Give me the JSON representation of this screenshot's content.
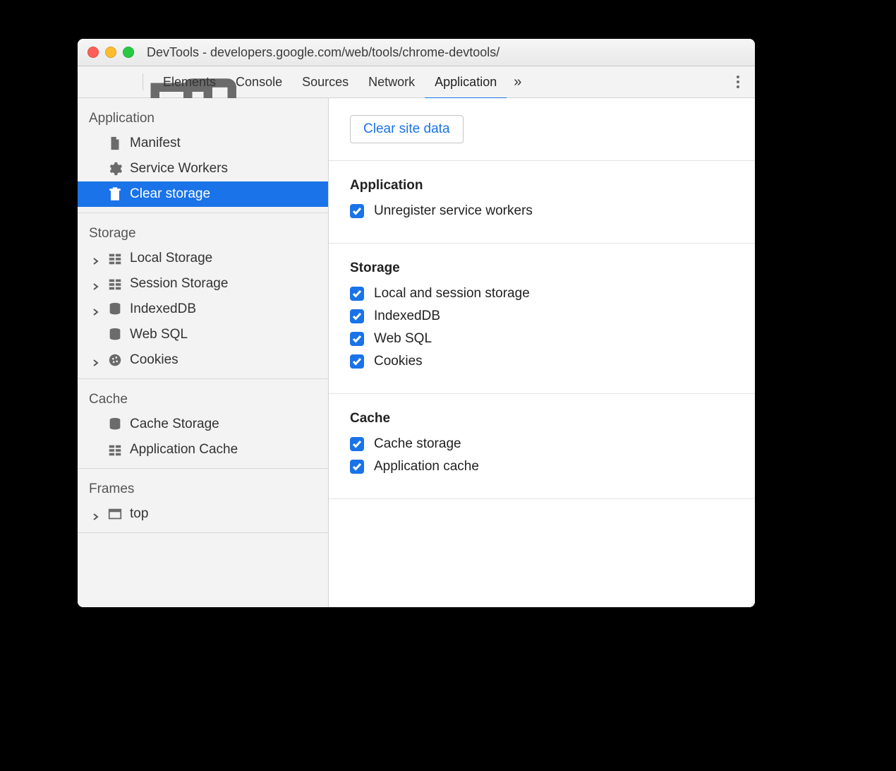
{
  "window_title": "DevTools - developers.google.com/web/tools/chrome-devtools/",
  "tabs": {
    "t0": "Elements",
    "t1": "Console",
    "t2": "Sources",
    "t3": "Network",
    "t4": "Application",
    "overflow": "»"
  },
  "sidebar": {
    "groups": [
      {
        "title": "Application",
        "items": [
          {
            "label": "Manifest",
            "icon": "file",
            "expandable": false
          },
          {
            "label": "Service Workers",
            "icon": "gear",
            "expandable": false
          },
          {
            "label": "Clear storage",
            "icon": "trash",
            "expandable": false,
            "selected": true
          }
        ]
      },
      {
        "title": "Storage",
        "items": [
          {
            "label": "Local Storage",
            "icon": "table",
            "expandable": true
          },
          {
            "label": "Session Storage",
            "icon": "table",
            "expandable": true
          },
          {
            "label": "IndexedDB",
            "icon": "db",
            "expandable": true
          },
          {
            "label": "Web SQL",
            "icon": "db",
            "expandable": false
          },
          {
            "label": "Cookies",
            "icon": "cookie",
            "expandable": true
          }
        ]
      },
      {
        "title": "Cache",
        "items": [
          {
            "label": "Cache Storage",
            "icon": "db",
            "expandable": false
          },
          {
            "label": "Application Cache",
            "icon": "table",
            "expandable": false
          }
        ]
      },
      {
        "title": "Frames",
        "items": [
          {
            "label": "top",
            "icon": "frame",
            "expandable": true
          }
        ]
      }
    ]
  },
  "main": {
    "clear_button": "Clear site data",
    "sections": [
      {
        "title": "Application",
        "items": [
          {
            "label": "Unregister service workers",
            "checked": true
          }
        ]
      },
      {
        "title": "Storage",
        "items": [
          {
            "label": "Local and session storage",
            "checked": true
          },
          {
            "label": "IndexedDB",
            "checked": true
          },
          {
            "label": "Web SQL",
            "checked": true
          },
          {
            "label": "Cookies",
            "checked": true
          }
        ]
      },
      {
        "title": "Cache",
        "items": [
          {
            "label": "Cache storage",
            "checked": true
          },
          {
            "label": "Application cache",
            "checked": true
          }
        ]
      }
    ]
  }
}
